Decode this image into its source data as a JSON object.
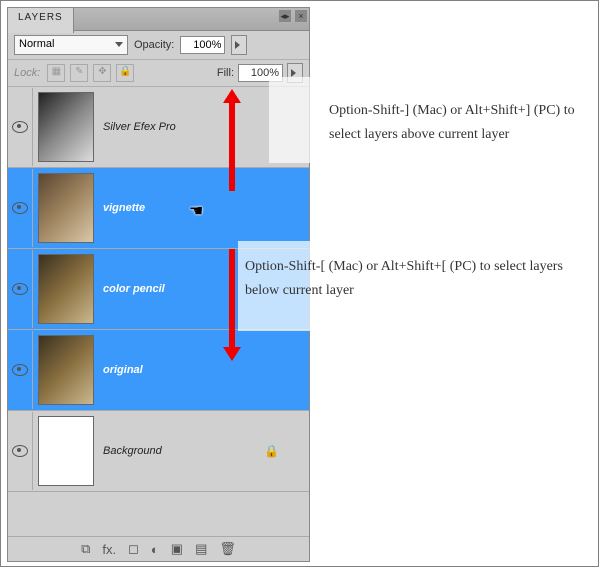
{
  "panel": {
    "title": "LAYERS",
    "blend": {
      "label": "Normal"
    },
    "opacity": {
      "label": "Opacity:",
      "value": "100%"
    },
    "lock": {
      "label": "Lock:"
    },
    "fill": {
      "label": "Fill:",
      "value": "100%"
    }
  },
  "layers": [
    {
      "name": "Silver Efex Pro",
      "selected": false,
      "visible": true,
      "thumb": "bw"
    },
    {
      "name": "vignette",
      "selected": true,
      "visible": true,
      "thumb": "sepia"
    },
    {
      "name": "color pencil",
      "selected": true,
      "visible": true,
      "thumb": "color"
    },
    {
      "name": "original",
      "selected": true,
      "visible": true,
      "thumb": "color"
    },
    {
      "name": "Background",
      "selected": false,
      "visible": true,
      "thumb": "white",
      "locked": true
    }
  ],
  "annotations": {
    "up": "Option-Shift-] (Mac) or Alt+Shift+] (PC) to select layers above current layer",
    "down": "Option-Shift-[ (Mac) or Alt+Shift+[ (PC) to select layers below current layer"
  },
  "icons": {
    "link": "⧉",
    "fx": "fx.",
    "mask": "◻",
    "adj": "◐",
    "group": "▣",
    "new": "▤",
    "trash": "🗑"
  }
}
